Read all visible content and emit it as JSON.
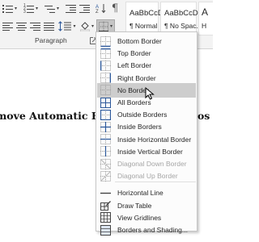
{
  "ribbon": {
    "group_label": "Paragraph",
    "styles": [
      {
        "sample": "AaBbCcDc",
        "name": "¶ Normal"
      },
      {
        "sample": "AaBbCcDc",
        "name": "¶ No Spac..."
      },
      {
        "sample": "A",
        "name": "H"
      }
    ]
  },
  "document": {
    "heading_left": "move Automatic Hor",
    "heading_right": "icros"
  },
  "menu": {
    "items": [
      {
        "label": "Bottom Border",
        "icon": "bottom-border-icon",
        "disabled": false,
        "hover": false
      },
      {
        "label": "Top Border",
        "icon": "top-border-icon",
        "disabled": false,
        "hover": false
      },
      {
        "label": "Left Border",
        "icon": "left-border-icon",
        "disabled": false,
        "hover": false
      },
      {
        "label": "Right Border",
        "icon": "right-border-icon",
        "disabled": false,
        "hover": false
      },
      {
        "label": "No Border",
        "icon": "no-border-icon",
        "disabled": false,
        "hover": true
      },
      {
        "label": "All Borders",
        "icon": "all-borders-icon",
        "disabled": false,
        "hover": false
      },
      {
        "label": "Outside Borders",
        "icon": "outside-borders-icon",
        "disabled": false,
        "hover": false
      },
      {
        "label": "Inside Borders",
        "icon": "inside-borders-icon",
        "disabled": false,
        "hover": false
      },
      {
        "label": "Inside Horizontal Border",
        "icon": "inside-horizontal-border-icon",
        "disabled": false,
        "hover": false
      },
      {
        "label": "Inside Vertical Border",
        "icon": "inside-vertical-border-icon",
        "disabled": false,
        "hover": false
      },
      {
        "label": "Diagonal Down Border",
        "icon": "diagonal-down-border-icon",
        "disabled": true,
        "hover": false
      },
      {
        "label": "Diagonal Up Border",
        "icon": "diagonal-up-border-icon",
        "disabled": true,
        "hover": false
      },
      {
        "label": "Horizontal Line",
        "icon": "horizontal-line-icon",
        "disabled": false,
        "hover": false
      },
      {
        "label": "Draw Table",
        "icon": "draw-table-icon",
        "disabled": false,
        "hover": false
      },
      {
        "label": "View Gridlines",
        "icon": "view-gridlines-icon",
        "disabled": false,
        "hover": false
      },
      {
        "label": "Borders and Shading...",
        "icon": "borders-and-shading-icon",
        "disabled": false,
        "hover": false
      }
    ]
  },
  "colors": {
    "ribbon_bg": "#f3f3f3",
    "menu_hover": "#cdcdcd",
    "border_blue": "#2b579a",
    "disabled_text": "#a6a6a6"
  }
}
